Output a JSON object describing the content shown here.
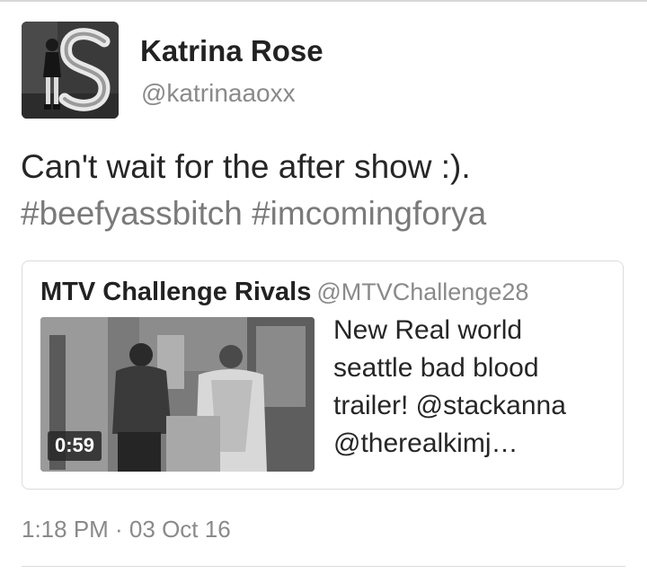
{
  "tweet": {
    "author": {
      "display_name": "Katrina Rose",
      "handle": "@katrinaaoxx",
      "avatar_icon": "profile-photo"
    },
    "text_line_1": "Can't wait for the after show :).",
    "hashtags": [
      "#beefyassbitch",
      "#imcomingforya"
    ],
    "timestamp": "1:18 PM · 03 Oct 16"
  },
  "quoted_tweet": {
    "display_name": "MTV Challenge Rivals",
    "handle": "@MTVChallenge28",
    "text_lines": [
      "New Real world",
      "seattle bad blood",
      "trailer! @stackanna",
      "@therealkimj…"
    ],
    "video": {
      "duration": "0:59"
    }
  },
  "colors": {
    "text": "#222222",
    "secondary": "#8a8a8a",
    "hashtag": "#7a7a7a",
    "border": "#dcdcdc"
  }
}
